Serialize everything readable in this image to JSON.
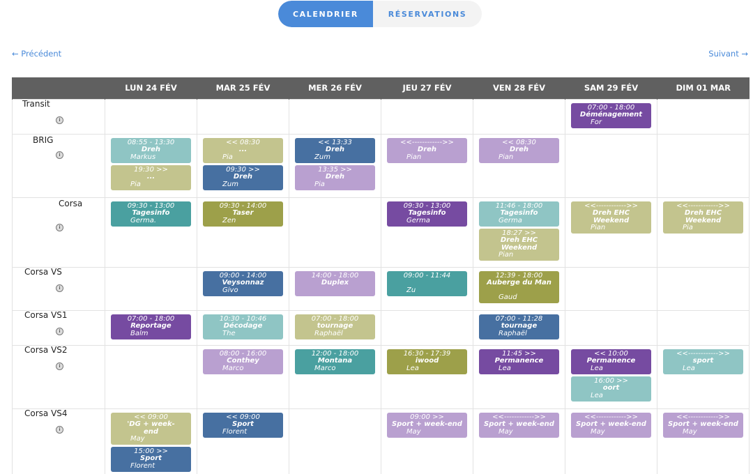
{
  "tabs": {
    "calendar": "CALENDRIER",
    "reservations": "RÉSERVATIONS"
  },
  "nav": {
    "prev": "← Précédent",
    "next": "Suivant →"
  },
  "colors": {
    "accent": "#4a8ad9",
    "header_bg": "#606060",
    "teal_light": "#8fc5c4",
    "olive_light": "#c3c48e",
    "blue": "#4770a1",
    "lavender": "#b9a0d0",
    "purple": "#764ba1",
    "teal": "#4aa0a0",
    "olive": "#9da04a"
  },
  "days": [
    "LUN 24 FÉV",
    "MAR 25 FÉV",
    "MER 26 FÉV",
    "JEU 27 FÉV",
    "VEN 28 FÉV",
    "SAM 29 FÉV",
    "DIM 01 MAR"
  ],
  "rows": [
    {
      "name": "Transit",
      "info_icon": "info-icon",
      "cells": [
        [],
        [],
        [],
        [],
        [],
        [
          {
            "time": "07:00 - 18:00",
            "lines": [
              "Déménagement",
              "For"
            ],
            "color": "purple"
          }
        ],
        []
      ]
    },
    {
      "name": "BRIG",
      "info_icon": "info-icon",
      "cells": [
        [
          {
            "time": "08:55 - 13:30",
            "lines": [
              "Dreh",
              "Markus"
            ],
            "color": "teal_light"
          },
          {
            "time": "19:30 >>",
            "lines": [
              "...",
              "Pia"
            ],
            "color": "olive_light"
          }
        ],
        [
          {
            "time": "<< 08:30",
            "lines": [
              "...",
              "Pia"
            ],
            "color": "olive_light"
          },
          {
            "time": "09:30 >>",
            "lines": [
              "Dreh",
              "Zum"
            ],
            "color": "blue"
          }
        ],
        [
          {
            "time": "<< 13:33",
            "lines": [
              "Dreh",
              "Zum"
            ],
            "color": "blue"
          },
          {
            "time": "13:35 >>",
            "lines": [
              "Dreh",
              "Pia"
            ],
            "color": "lavender"
          }
        ],
        [
          {
            "time": "<<------------>>",
            "lines": [
              "Dreh",
              "Pian"
            ],
            "color": "lavender"
          }
        ],
        [
          {
            "time": "<< 08:30",
            "lines": [
              "Dreh",
              "Pian"
            ],
            "color": "lavender"
          }
        ],
        [],
        []
      ]
    },
    {
      "name": "Corsa",
      "info_icon": "info-icon",
      "cells": [
        [
          {
            "time": "09:30 - 13:00",
            "lines": [
              "Tagesinfo",
              "Germa."
            ],
            "color": "teal"
          }
        ],
        [
          {
            "time": "09:30 - 14:00",
            "lines": [
              "Taser",
              "Zen"
            ],
            "color": "olive"
          }
        ],
        [],
        [
          {
            "time": "09:30 - 13:00",
            "lines": [
              "Tagesinfo",
              "Germa"
            ],
            "color": "purple"
          }
        ],
        [
          {
            "time": "11:46 - 18:00",
            "lines": [
              "Tagesinfo",
              "Germa"
            ],
            "color": "teal_light"
          },
          {
            "time": "18:27 >>",
            "lines": [
              "Dreh EHC",
              "Weekend",
              "Pian"
            ],
            "color": "olive_light"
          }
        ],
        [
          {
            "time": "<<------------>>",
            "lines": [
              "Dreh EHC",
              "Weekend",
              "Pian"
            ],
            "color": "olive_light"
          }
        ],
        [
          {
            "time": "<<------------>>",
            "lines": [
              "Dreh EHC",
              "Weekend",
              "Pia"
            ],
            "color": "olive_light"
          }
        ]
      ]
    },
    {
      "name": "Corsa VS",
      "info_icon": "info-icon",
      "cells": [
        [],
        [
          {
            "time": "09:00 - 14:00",
            "lines": [
              "Veysonnaz",
              "Givo"
            ],
            "color": "blue"
          }
        ],
        [
          {
            "time": "14:00 - 18:00",
            "lines": [
              "Duplex",
              ""
            ],
            "color": "lavender"
          }
        ],
        [
          {
            "time": "09:00 - 11:44",
            "lines": [
              "",
              "Zu"
            ],
            "color": "teal"
          }
        ],
        [
          {
            "time": "12:39 - 18:00",
            "lines": [
              "Auberge du Man",
              "",
              "Gaud"
            ],
            "color": "olive"
          }
        ],
        [],
        []
      ]
    },
    {
      "name": "Corsa VS1",
      "info_icon": "info-icon",
      "cells": [
        [
          {
            "time": "07:00 - 18:00",
            "lines": [
              "Reportage",
              "Balm"
            ],
            "color": "purple"
          }
        ],
        [
          {
            "time": "10:30 - 10:46",
            "lines": [
              "Décodage",
              "The"
            ],
            "color": "teal_light"
          }
        ],
        [
          {
            "time": "07:00 - 18:00",
            "lines": [
              "tournage",
              "Raphaël"
            ],
            "color": "olive_light"
          }
        ],
        [],
        [
          {
            "time": "07:00 - 11:28",
            "lines": [
              "tournage",
              "Raphaël"
            ],
            "color": "blue"
          }
        ],
        [],
        []
      ]
    },
    {
      "name": "Corsa VS2",
      "info_icon": "info-icon",
      "cells": [
        [],
        [
          {
            "time": "08:00 - 16:00",
            "lines": [
              "Conthey",
              "Marco"
            ],
            "color": "lavender"
          }
        ],
        [
          {
            "time": "12:00 - 18:00",
            "lines": [
              "Montana",
              "Marco"
            ],
            "color": "teal"
          }
        ],
        [
          {
            "time": "16:30 - 17:39",
            "lines": [
              "iwood",
              "Lea"
            ],
            "color": "olive"
          }
        ],
        [
          {
            "time": "11:45 >>",
            "lines": [
              "Permanence",
              "Lea"
            ],
            "color": "purple"
          }
        ],
        [
          {
            "time": "<< 10:00",
            "lines": [
              "Permanence",
              "Lea"
            ],
            "color": "purple"
          },
          {
            "time": "16:00 >>",
            "lines": [
              "oort",
              "Lea"
            ],
            "color": "teal_light"
          }
        ],
        [
          {
            "time": "<<------------>>",
            "lines": [
              "sport",
              "Lea"
            ],
            "color": "teal_light"
          }
        ]
      ]
    },
    {
      "name": "Corsa VS4",
      "info_icon": "info-icon",
      "cells": [
        [
          {
            "time": "<< 09:00",
            "lines": [
              "'DG + week-",
              "end",
              "May"
            ],
            "color": "olive_light"
          },
          {
            "time": "15:00 >>",
            "lines": [
              "Sport",
              "Florent"
            ],
            "color": "blue"
          }
        ],
        [
          {
            "time": "<< 09:00",
            "lines": [
              "Sport",
              "Florent"
            ],
            "color": "blue"
          }
        ],
        [],
        [
          {
            "time": "09:00 >>",
            "lines": [
              "Sport + week-end",
              "May"
            ],
            "color": "lavender"
          }
        ],
        [
          {
            "time": "<<------------>>",
            "lines": [
              "Sport + week-end",
              "May"
            ],
            "color": "lavender"
          }
        ],
        [
          {
            "time": "<<------------>>",
            "lines": [
              "Sport + week-end",
              "May"
            ],
            "color": "lavender"
          }
        ],
        [
          {
            "time": "<<------------>>",
            "lines": [
              "Sport + week-end",
              "May"
            ],
            "color": "lavender"
          }
        ]
      ]
    }
  ]
}
